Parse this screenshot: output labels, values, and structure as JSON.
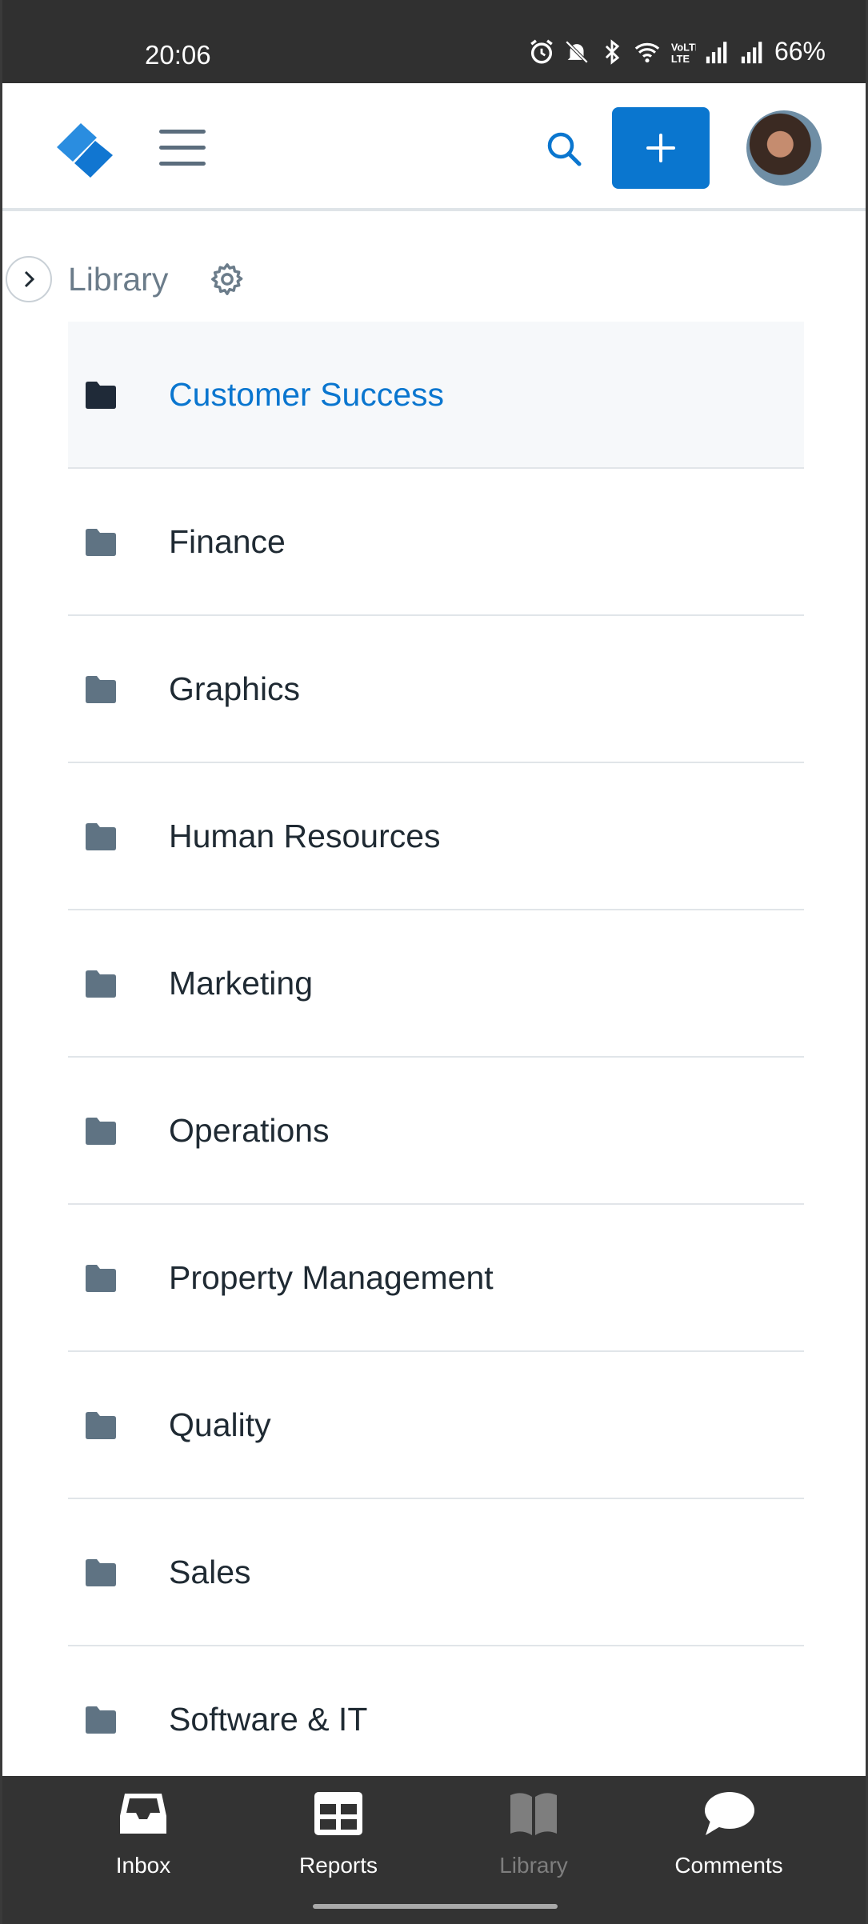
{
  "status_bar": {
    "time": "20:06",
    "battery": "66%",
    "icons": [
      "alarm-icon",
      "mute-icon",
      "bluetooth-icon",
      "wifi-icon",
      "volte-icon",
      "signal-icon",
      "signal-icon"
    ]
  },
  "header": {
    "logo": "logo-icon",
    "menu": "hamburger-menu-icon",
    "search": "search-icon",
    "add": "plus-icon",
    "accent_color": "#0a76cf"
  },
  "breadcrumb": {
    "title": "Library"
  },
  "folders": [
    {
      "label": "Customer Success",
      "selected": true
    },
    {
      "label": "Finance"
    },
    {
      "label": "Graphics"
    },
    {
      "label": "Human Resources"
    },
    {
      "label": "Marketing"
    },
    {
      "label": "Operations"
    },
    {
      "label": "Property Management"
    },
    {
      "label": "Quality"
    },
    {
      "label": "Sales"
    },
    {
      "label": "Software & IT"
    }
  ],
  "bottom_nav": [
    {
      "label": "Inbox",
      "icon": "inbox-icon"
    },
    {
      "label": "Reports",
      "icon": "reports-icon"
    },
    {
      "label": "Library",
      "icon": "library-book-icon",
      "active": true
    },
    {
      "label": "Comments",
      "icon": "comment-icon"
    }
  ]
}
